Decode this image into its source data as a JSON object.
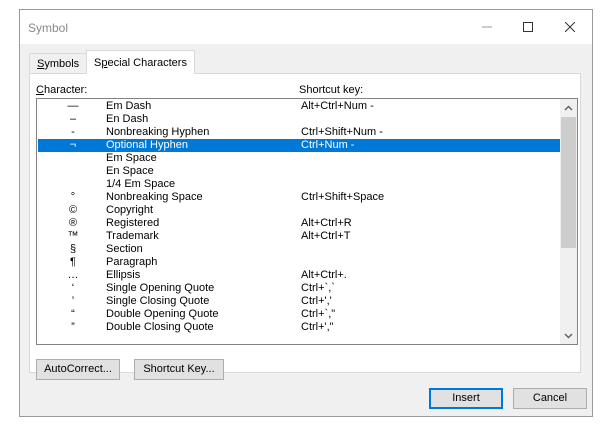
{
  "window": {
    "title": "Symbol"
  },
  "tabs": [
    {
      "label": "Symbols",
      "underline": "S"
    },
    {
      "label": "Special Characters",
      "underline": "p"
    }
  ],
  "headers": {
    "character": "Character:",
    "character_underline": "C",
    "shortcut": "Shortcut key:"
  },
  "rows": [
    {
      "char": "—",
      "name": "Em Dash",
      "shortcut": "Alt+Ctrl+Num -"
    },
    {
      "char": "–",
      "name": "En Dash",
      "shortcut": ""
    },
    {
      "char": "-",
      "name": "Nonbreaking Hyphen",
      "shortcut": "Ctrl+Shift+Num -"
    },
    {
      "char": "¬",
      "name": "Optional Hyphen",
      "shortcut": "Ctrl+Num -",
      "selected": true
    },
    {
      "char": "",
      "name": "Em Space",
      "shortcut": ""
    },
    {
      "char": "",
      "name": "En Space",
      "shortcut": ""
    },
    {
      "char": "",
      "name": "1/4 Em Space",
      "shortcut": ""
    },
    {
      "char": "°",
      "name": "Nonbreaking Space",
      "shortcut": "Ctrl+Shift+Space"
    },
    {
      "char": "©",
      "name": "Copyright",
      "shortcut": ""
    },
    {
      "char": "®",
      "name": "Registered",
      "shortcut": "Alt+Ctrl+R"
    },
    {
      "char": "™",
      "name": "Trademark",
      "shortcut": "Alt+Ctrl+T"
    },
    {
      "char": "§",
      "name": "Section",
      "shortcut": ""
    },
    {
      "char": "¶",
      "name": "Paragraph",
      "shortcut": ""
    },
    {
      "char": "…",
      "name": "Ellipsis",
      "shortcut": "Alt+Ctrl+."
    },
    {
      "char": "‘",
      "name": "Single Opening Quote",
      "shortcut": "Ctrl+`,`"
    },
    {
      "char": "’",
      "name": "Single Closing Quote",
      "shortcut": "Ctrl+','"
    },
    {
      "char": "“",
      "name": "Double Opening Quote",
      "shortcut": "Ctrl+`,\""
    },
    {
      "char": "”",
      "name": "Double Closing Quote",
      "shortcut": "Ctrl+',\""
    }
  ],
  "buttons": {
    "autocorrect": "AutoCorrect...",
    "shortcut_key": "Shortcut Key...",
    "insert": "Insert",
    "cancel": "Cancel"
  },
  "colors": {
    "selection": "#0078d7",
    "default_button_border": "#0078d7"
  }
}
